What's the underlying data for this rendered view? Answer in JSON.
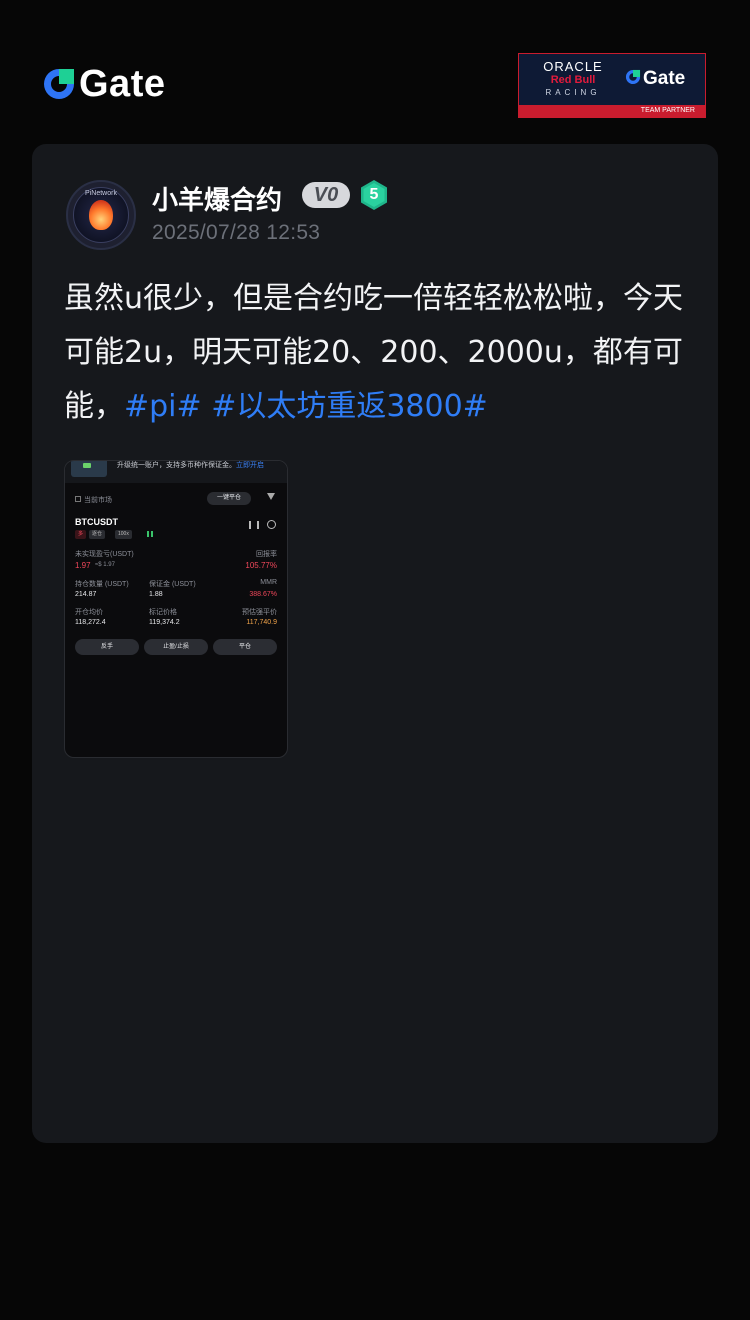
{
  "header": {
    "logo_text": "Gate",
    "partner": {
      "oracle": "ORACLE",
      "redbull": "Red Bull",
      "racing": "RACING",
      "gate": "Gate",
      "footer": "TEAM PARTNER"
    }
  },
  "post": {
    "username": "小羊爆合约",
    "vip_badge": "V0",
    "level_badge": "5",
    "timestamp": "2025/07/28 12:53",
    "body_text": "虽然u很少，但是合约吃一倍轻轻松松啦，今天可能2u，明天可能20、200、2000u，都有可能，",
    "hashtags": [
      "#pi#",
      "#以太坊重返3800#"
    ],
    "avatar_text": "PiNetwork"
  },
  "screenshot": {
    "banner_text": "升级统一账户，支持多币种作保证金。",
    "banner_link": "立即开启",
    "current_market_label": "当前市场",
    "close_all_label": "一键平仓",
    "symbol": "BTCUSDT",
    "tags": [
      "多",
      "逐仓",
      "100x"
    ],
    "unrealized_label": "未实现盈亏(USDT)",
    "unrealized_value": "1.97",
    "unrealized_sub": "≈$ 1.97",
    "roe_label": "回报率",
    "roe_value": "105.77%",
    "size_label": "持仓数量 (USDT)",
    "size_value": "214.87",
    "margin_label": "保证金 (USDT)",
    "margin_value": "1.88",
    "mmr_label": "MMR",
    "mmr_value": "388.67%",
    "entry_label": "开仓均价",
    "entry_value": "118,272.4",
    "mark_label": "标记价格",
    "mark_value": "119,374.2",
    "liq_label": "预估强平价",
    "liq_value": "117,740.9",
    "buttons": [
      "反手",
      "止盈/止损",
      "平仓"
    ]
  },
  "colors": {
    "background": "#060606",
    "card": "#16181c",
    "hashtag": "#2f7df6",
    "timestamp": "#6c7079",
    "loss_red": "#f0475a"
  }
}
